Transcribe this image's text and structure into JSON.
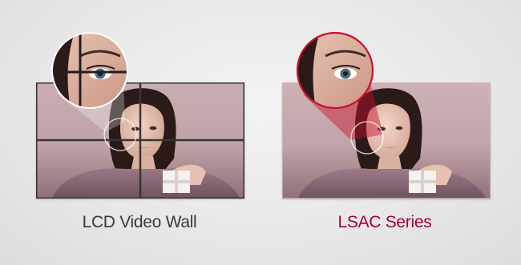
{
  "left": {
    "caption": "LCD Video Wall",
    "caption_color": "#3a3a3a"
  },
  "right": {
    "caption": "LSAC Series",
    "caption_color": "#a50034"
  },
  "colors": {
    "bezel": "#3b3332",
    "highlight_fill": "#c8102e",
    "background": "#e9e9e9"
  }
}
